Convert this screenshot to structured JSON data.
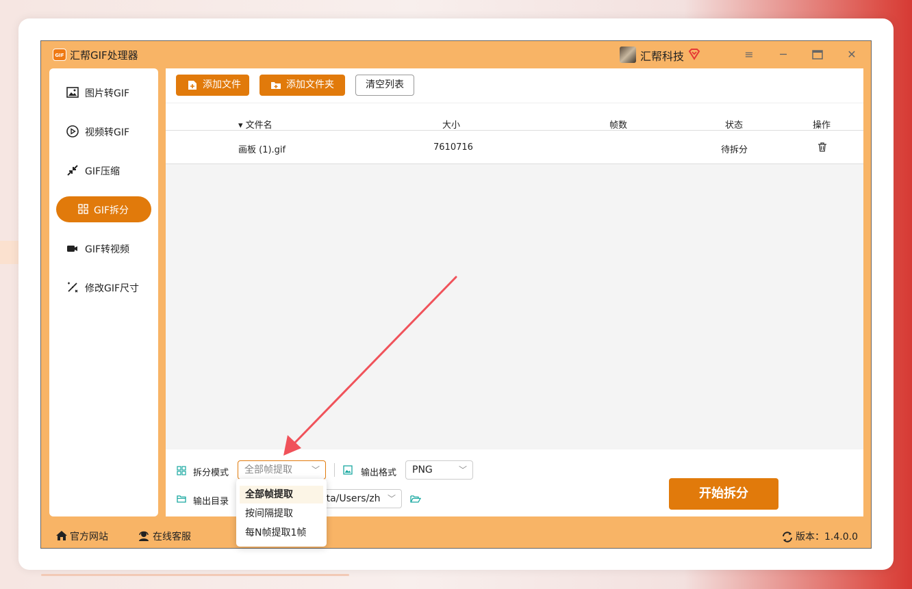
{
  "app": {
    "title": "汇帮GIF处理器",
    "logo_text": "GIF",
    "username": "汇帮科技",
    "window_controls": [
      "menu",
      "minimize",
      "maximize",
      "close"
    ]
  },
  "sidebar": {
    "items": [
      {
        "label": "图片转GIF",
        "icon": "image-icon",
        "active": false
      },
      {
        "label": "视频转GIF",
        "icon": "play-icon",
        "active": false
      },
      {
        "label": "GIF压缩",
        "icon": "compress-icon",
        "active": false
      },
      {
        "label": "GIF拆分",
        "icon": "grid-icon",
        "active": true
      },
      {
        "label": "GIF转视频",
        "icon": "video-camera-icon",
        "active": false
      },
      {
        "label": "修改GIF尺寸",
        "icon": "resize-icon",
        "active": false
      }
    ]
  },
  "toolbar": {
    "add_file": "添加文件",
    "add_folder": "添加文件夹",
    "clear_list": "清空列表"
  },
  "table": {
    "headers": [
      "文件名",
      "大小",
      "帧数",
      "状态",
      "操作"
    ],
    "rows": [
      {
        "name": "画板 (1).gif",
        "size": "7610716",
        "frames": "",
        "status": "待拆分"
      }
    ]
  },
  "settings": {
    "split_mode_label": "拆分模式",
    "split_mode_value": "全部帧提取",
    "output_format_label": "输出格式",
    "output_format_value": "PNG",
    "output_dir_label": "输出目录",
    "output_dir_value": "ata/Users/zh",
    "start_button": "开始拆分"
  },
  "dropdown": {
    "options": [
      "全部帧提取",
      "按间隔提取",
      "每N帧提取1帧"
    ],
    "selected_index": 0
  },
  "footer": {
    "website": "官方网站",
    "support": "在线客服",
    "version": "版本：1.4.0.0"
  },
  "colors": {
    "accent": "#e17a0b",
    "window_bg": "#f8b466",
    "annotation_arrow": "#f0525a"
  }
}
